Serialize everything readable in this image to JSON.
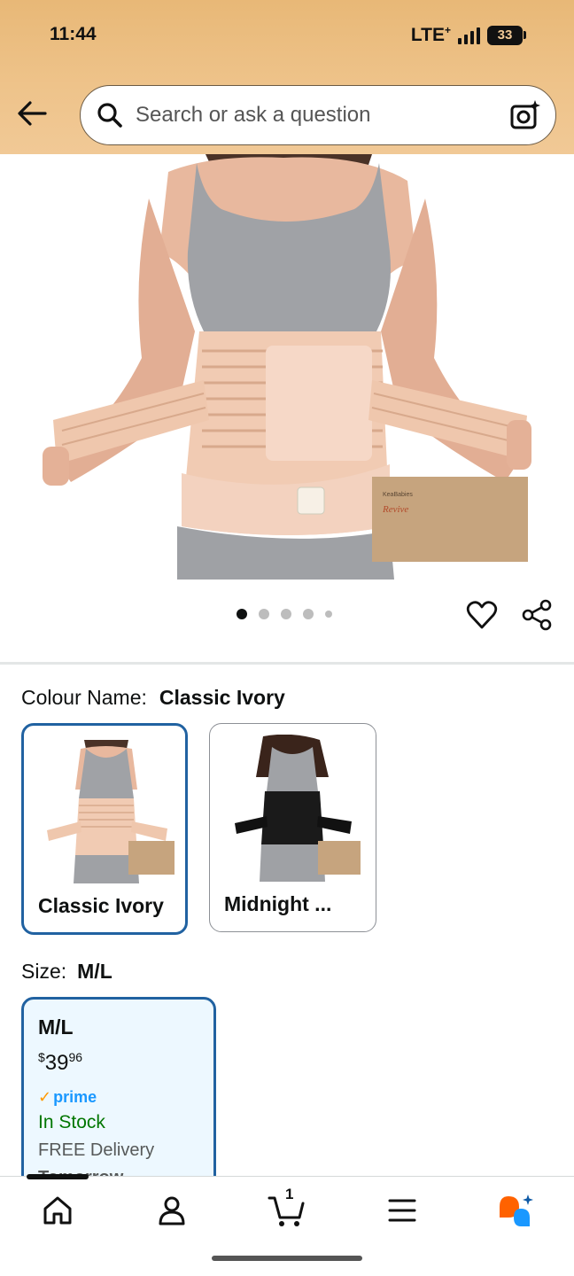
{
  "status_bar": {
    "time": "11:44",
    "network": "LTE",
    "network_sup": "+",
    "battery": "33"
  },
  "search": {
    "placeholder": "Search or ask a question",
    "icon": "search-icon",
    "camera_icon": "camera-sparkle-icon"
  },
  "gallery": {
    "dots": 5,
    "active_index": 0,
    "actions": [
      "heart-icon",
      "share-icon"
    ]
  },
  "colour": {
    "label": "Colour Name:",
    "selected": "Classic Ivory",
    "options": [
      {
        "label": "Classic Ivory",
        "selected": true
      },
      {
        "label": "Midnight ...",
        "selected": false
      }
    ]
  },
  "size": {
    "label": "Size:",
    "selected": "M/L",
    "options": [
      {
        "label": "M/L",
        "price_symbol": "$",
        "price_whole": "39",
        "price_fraction": "96",
        "prime": "prime",
        "stock": "In Stock",
        "delivery": "FREE Delivery",
        "delivery_day": "Tomorrow"
      }
    ]
  },
  "bottom_nav": {
    "items": [
      "home-icon",
      "account-icon",
      "cart-icon",
      "menu-icon",
      "rufus-icon"
    ],
    "cart_count": "1"
  },
  "colors": {
    "accent": "#2162a1",
    "header": "#eec38a",
    "in_stock": "#007600",
    "prime": "#1a98ff"
  }
}
